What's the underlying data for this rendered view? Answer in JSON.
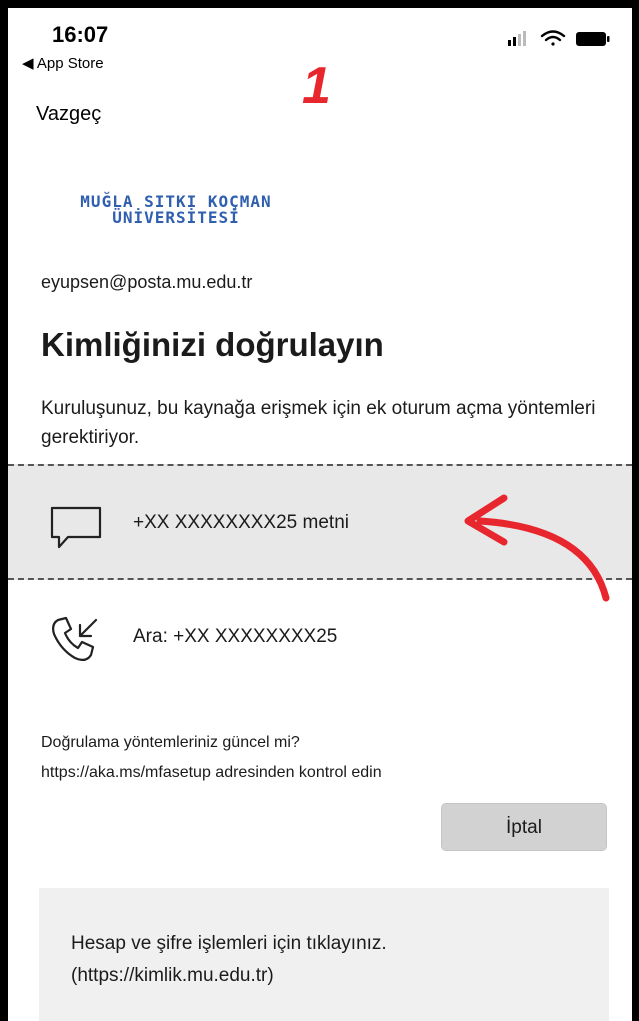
{
  "status_bar": {
    "time": "16:07",
    "back_app": "◀ App Store"
  },
  "annotation": {
    "step_number": "1",
    "arrow_color": "#e8262e"
  },
  "header": {
    "cancel_label": "Vazgeç"
  },
  "logo": {
    "line1": "MUĞLA SITKI KOÇMAN",
    "line2": "ÜNİVERSİTESİ",
    "color": "#2f5fae"
  },
  "account": {
    "email": "eyupsen@posta.mu.edu.tr"
  },
  "main": {
    "title": "Kimliğinizi doğrulayın",
    "description": "Kuruluşunuz, bu kaynağa erişmek için ek oturum açma yöntemleri gerektiriyor."
  },
  "options": [
    {
      "icon": "message-icon",
      "label": "+XX XXXXXXXX25 metni",
      "selected": true
    },
    {
      "icon": "phone-incoming-icon",
      "label": "Ara: +XX XXXXXXXX25",
      "selected": false
    }
  ],
  "hint": {
    "line1": "Doğrulama yöntemleriniz güncel mi?",
    "line2": "https://aka.ms/mfasetup adresinden kontrol edin"
  },
  "actions": {
    "cancel_label": "İptal"
  },
  "footer": {
    "line1": "Hesap ve şifre işlemleri için tıklayınız.",
    "line2": "(https://kimlik.mu.edu.tr)"
  }
}
